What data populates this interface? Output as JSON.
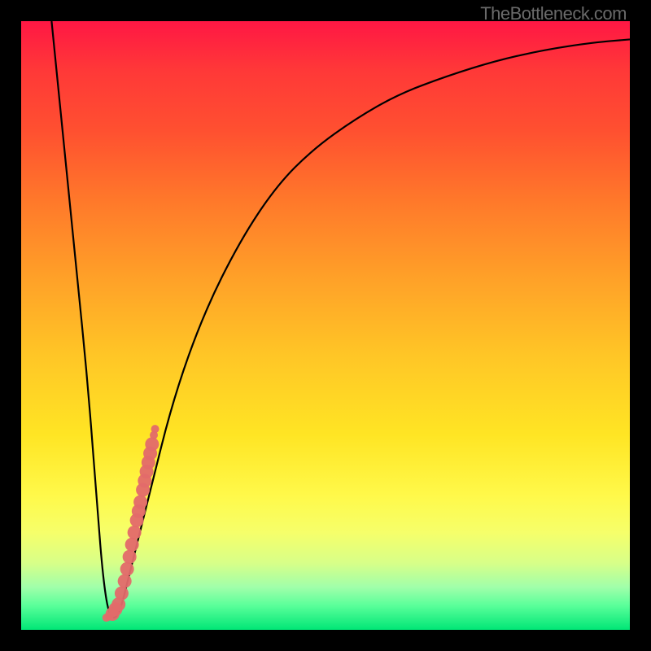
{
  "watermark": "TheBottleneck.com",
  "chart_data": {
    "type": "line",
    "title": "",
    "xlabel": "",
    "ylabel": "",
    "xlim": [
      0,
      100
    ],
    "ylim": [
      0,
      100
    ],
    "curve": {
      "x": [
        5,
        7,
        9,
        11,
        12.5,
        13.5,
        14.5,
        16,
        18,
        21,
        25,
        30,
        36,
        42,
        48,
        55,
        62,
        70,
        78,
        86,
        94,
        100
      ],
      "y": [
        100,
        80,
        60,
        40,
        20,
        8,
        2,
        2,
        10,
        22,
        38,
        52,
        64,
        73,
        79,
        84,
        88,
        91,
        93.5,
        95.3,
        96.5,
        97
      ]
    },
    "scatter": {
      "x": [
        14,
        14.5,
        15,
        15.5,
        16,
        16.5,
        17,
        17.4,
        17.8,
        18.2,
        18.6,
        19,
        19.3,
        19.6,
        20,
        20.3,
        20.6,
        20.9,
        21.2,
        21.5,
        21.8,
        22
      ],
      "y": [
        2,
        2.2,
        2.6,
        3.4,
        4.2,
        6,
        8,
        10,
        12,
        14,
        16,
        18,
        19.5,
        21,
        23,
        24.5,
        26,
        27.5,
        29,
        30.5,
        32,
        33
      ]
    },
    "dot_color": "#e36a6a",
    "curve_color": "#000000",
    "gradient_note": "vertical red→yellow→green"
  }
}
